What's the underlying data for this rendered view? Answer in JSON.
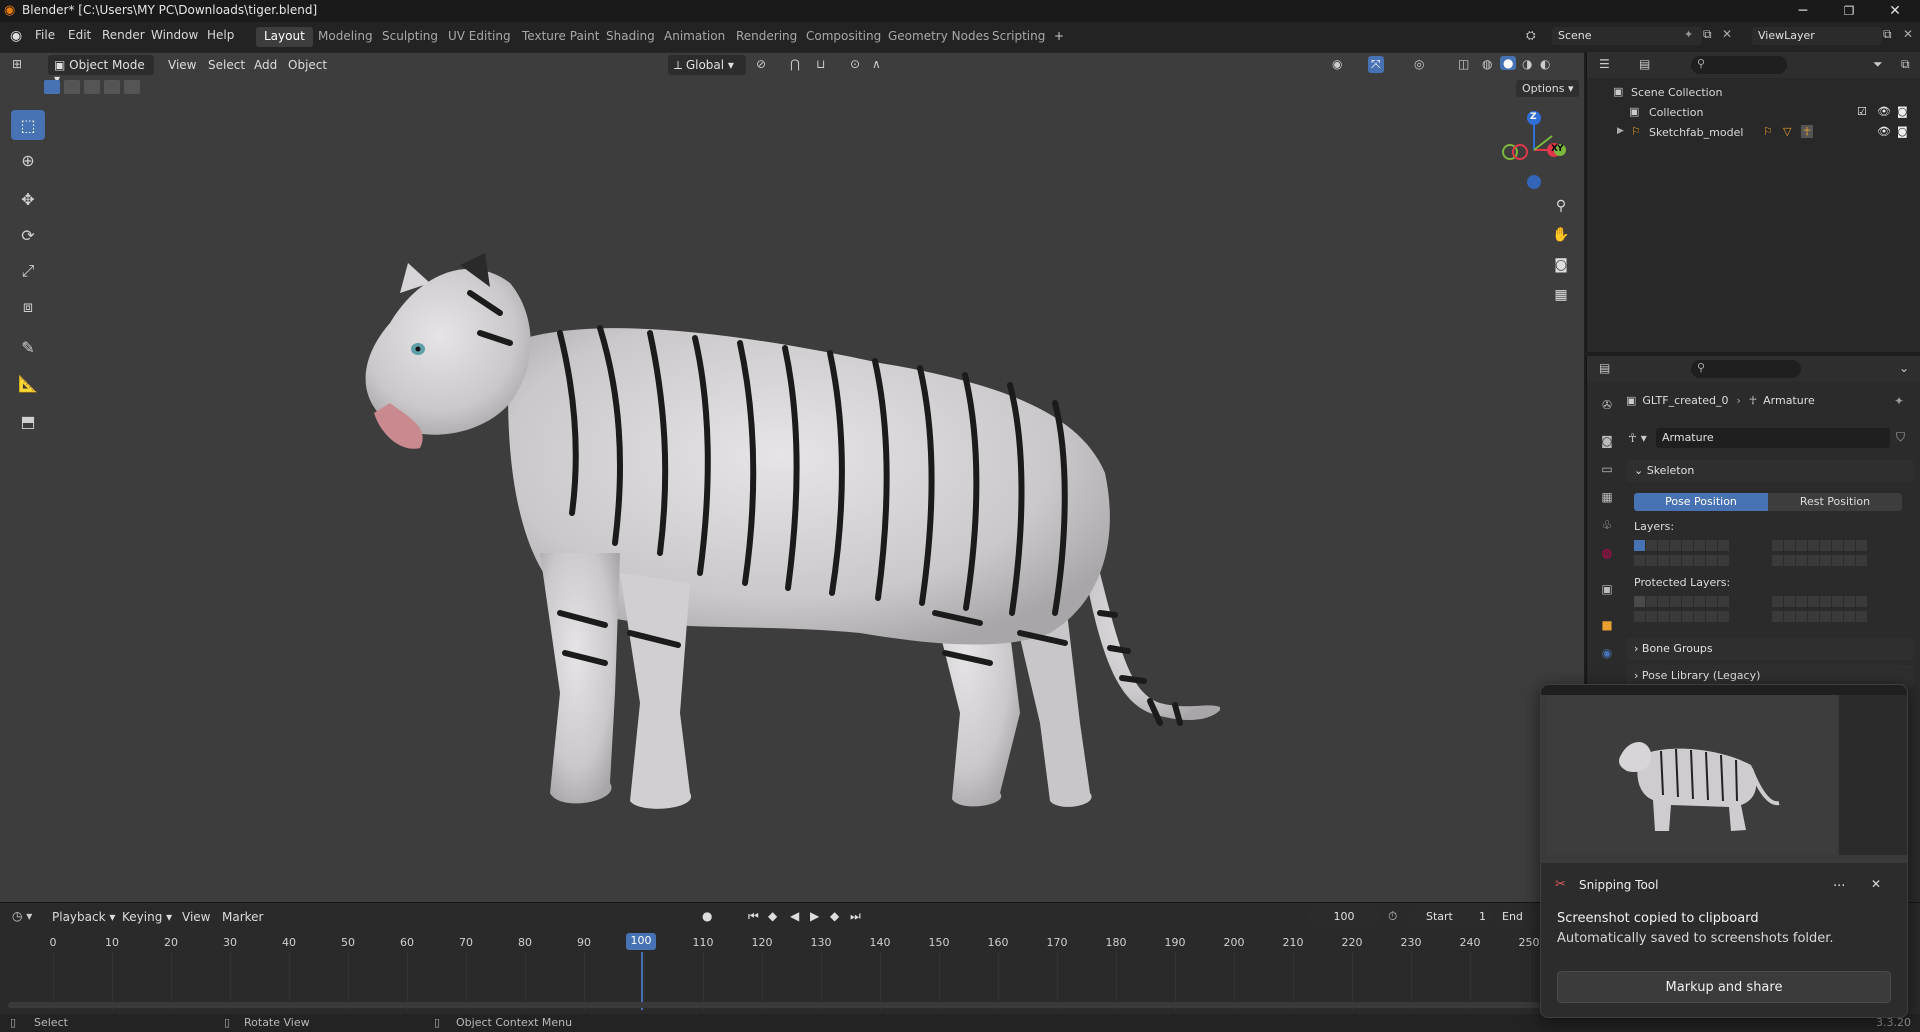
{
  "window": {
    "title": "Blender* [C:\\Users\\MY PC\\Downloads\\tiger.blend]",
    "minimize_icon": "minimize-icon",
    "restore_icon": "restore-icon",
    "close_icon": "close-icon"
  },
  "menu": {
    "items": [
      "File",
      "Edit",
      "Render",
      "Window",
      "Help"
    ]
  },
  "workspaces": {
    "tabs": [
      "Layout",
      "Modeling",
      "Sculpting",
      "UV Editing",
      "Texture Paint",
      "Shading",
      "Animation",
      "Rendering",
      "Compositing",
      "Geometry Nodes",
      "Scripting"
    ],
    "active": "Layout",
    "add_label": "+"
  },
  "scene": {
    "label": "Scene",
    "viewlayer": "ViewLayer"
  },
  "viewport": {
    "mode": "Object Mode",
    "menus": [
      "View",
      "Select",
      "Add",
      "Object"
    ],
    "orientation": "Global",
    "options_label": "Options",
    "gizmo": {
      "z": "Z",
      "y": "Y",
      "x": "X"
    }
  },
  "outliner": {
    "items": [
      {
        "label": "Scene Collection"
      },
      {
        "label": "Collection"
      },
      {
        "label": "Sketchfab_model"
      }
    ]
  },
  "properties": {
    "breadcrumb_object": "GLTF_created_0",
    "breadcrumb_data": "Armature",
    "data_name": "Armature",
    "skeleton_label": "Skeleton",
    "pose_position": "Pose Position",
    "rest_position": "Rest Position",
    "layers_label": "Layers:",
    "protected_layers_label": "Protected Layers:",
    "bone_groups_label": "Bone Groups",
    "pose_library_label": "Pose Library (Legacy)"
  },
  "timeline": {
    "menus": [
      "Playback",
      "Keying",
      "View",
      "Marker"
    ],
    "current_frame": "100",
    "start_label": "Start",
    "start_value": "1",
    "end_label": "End",
    "ticks": [
      "0",
      "10",
      "20",
      "30",
      "40",
      "50",
      "60",
      "70",
      "80",
      "90",
      "100",
      "110",
      "120",
      "130",
      "140",
      "150",
      "160",
      "170",
      "180",
      "190",
      "200",
      "210",
      "220",
      "230",
      "240",
      "250"
    ],
    "playhead_frame": "100"
  },
  "statusbar": {
    "select": "Select",
    "rotate": "Rotate View",
    "context": "Object Context Menu",
    "version": "3.3.20"
  },
  "toast": {
    "app": "Snipping Tool",
    "line1": "Screenshot copied to clipboard",
    "line2": "Automatically saved to screenshots folder.",
    "button": "Markup and share",
    "more": "...",
    "close": "✕"
  },
  "colors": {
    "accent": "#4772b3",
    "axis_x": "#e0374a",
    "axis_y": "#7cb83b",
    "axis_z": "#2f6fd6",
    "object_orange": "#e8a033"
  }
}
